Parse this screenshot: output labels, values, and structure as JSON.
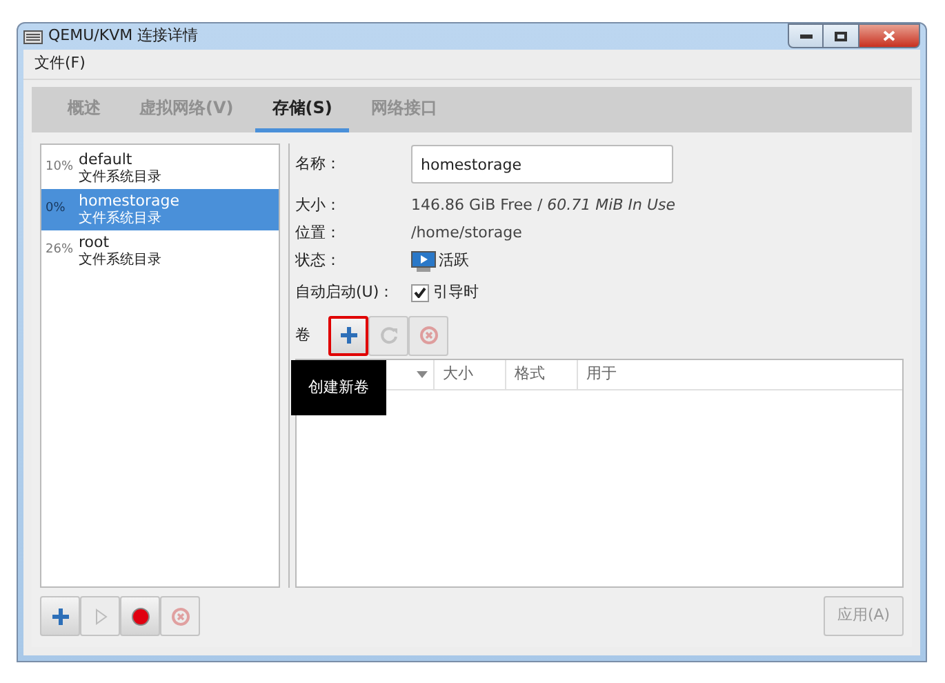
{
  "window": {
    "title": "QEMU/KVM 连接详情"
  },
  "menu": [
    "文件(F)"
  ],
  "tabs": [
    {
      "label": "概述",
      "selected": false
    },
    {
      "label": "虚拟网络(V)",
      "selected": false
    },
    {
      "label": "存储(S)",
      "selected": true
    },
    {
      "label": "网络接口",
      "selected": false
    }
  ],
  "pools": [
    {
      "usage": "10%",
      "name": "default",
      "type": "文件系统目录",
      "selected": false
    },
    {
      "usage": "0%",
      "name": "homestorage",
      "type": "文件系统目录",
      "selected": true
    },
    {
      "usage": "26%",
      "name": "root",
      "type": "文件系统目录",
      "selected": false
    }
  ],
  "details": {
    "name_label": "名称：",
    "name_value": "homestorage",
    "size_label": "大小：",
    "size_value": "146.86 GiB Free / *60.71 MiB In Use*",
    "location_label": "位置：",
    "location_value": "/home/storage",
    "state_label": "状态：",
    "state_value": "活跃",
    "autostart_label": "自动启动(U)：",
    "autostart_option": "引导时",
    "autostart_checked": true
  },
  "volumes": {
    "label": "卷",
    "tools": [
      {
        "kind": "add",
        "disabled": false,
        "highlighted": true
      },
      {
        "kind": "refresh",
        "disabled": true,
        "highlighted": false
      },
      {
        "kind": "delete",
        "disabled": true,
        "highlighted": false
      }
    ],
    "tooltip": "创建新卷",
    "columns": [
      "大小",
      "格式",
      "用于"
    ]
  },
  "pool_tools": [
    {
      "kind": "add",
      "disabled": false
    },
    {
      "kind": "start",
      "disabled": true
    },
    {
      "kind": "stop",
      "disabled": false
    },
    {
      "kind": "delete",
      "disabled": true
    }
  ],
  "apply": {
    "label": "应用(A)",
    "disabled": true
  }
}
